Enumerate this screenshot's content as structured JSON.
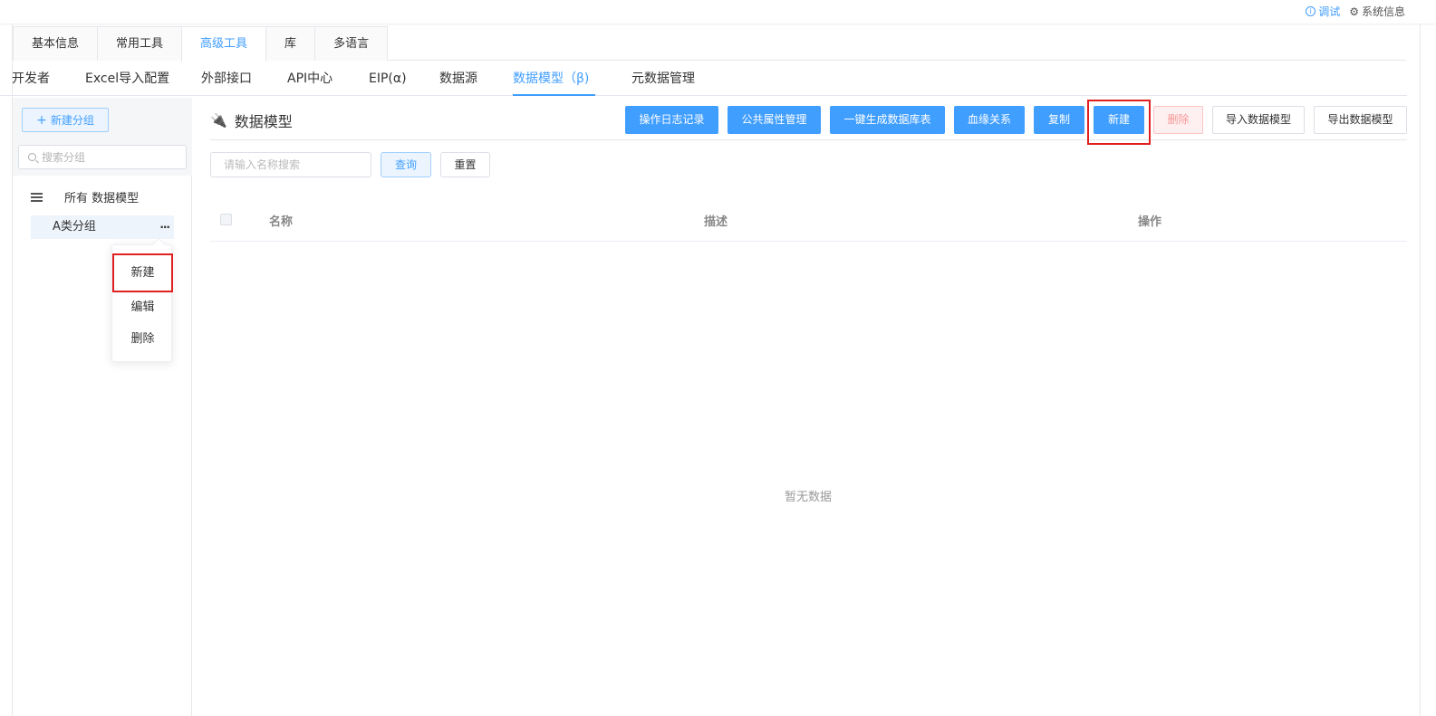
{
  "topbar": {
    "debug": "调试",
    "sysinfo": "系统信息"
  },
  "tabs1": [
    {
      "label": "基本信息",
      "active": false
    },
    {
      "label": "常用工具",
      "active": false
    },
    {
      "label": "高级工具",
      "active": true
    },
    {
      "label": "库",
      "active": false
    },
    {
      "label": "多语言",
      "active": false
    }
  ],
  "tabs2": [
    {
      "label": "开发者"
    },
    {
      "label": "Excel导入配置"
    },
    {
      "label": "外部接口"
    },
    {
      "label": "API中心"
    },
    {
      "label": "EIP(α)"
    },
    {
      "label": "数据源"
    },
    {
      "label": "数据模型（β)"
    },
    {
      "label": "元数据管理"
    }
  ],
  "sidebar": {
    "new_group": "新建分组",
    "search_placeholder": "搜索分组",
    "tree_all": "所有 数据模型",
    "tree_item": "A类分组",
    "more": "···",
    "menu": [
      "新建",
      "编辑",
      "删除"
    ]
  },
  "main": {
    "title": "数据模型",
    "buttons": [
      "操作日志记录",
      "公共属性管理",
      "一键生成数据库表",
      "血缘关系",
      "复制",
      "新建",
      "删除",
      "导入数据模型",
      "导出数据模型"
    ],
    "name_search_placeholder": "请输入名称搜索",
    "query": "查询",
    "reset": "重置",
    "columns": [
      "名称",
      "描述",
      "操作"
    ],
    "empty": "暂无数据"
  }
}
